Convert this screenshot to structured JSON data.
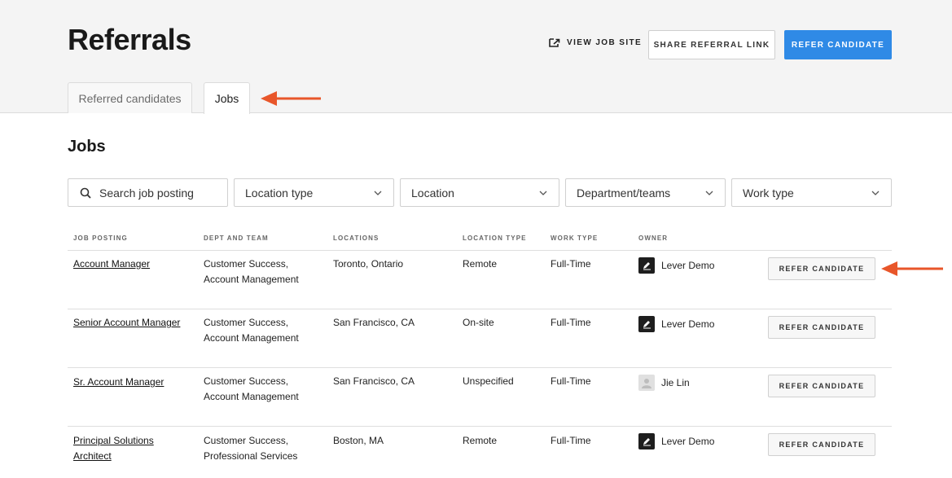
{
  "header": {
    "title": "Referrals",
    "view_job_site": "VIEW JOB SITE",
    "share_referral_link": "SHARE REFERRAL LINK",
    "refer_candidate": "REFER CANDIDATE"
  },
  "tabs": [
    {
      "label": "Referred candidates",
      "active": false
    },
    {
      "label": "Jobs",
      "active": true
    }
  ],
  "section_title": "Jobs",
  "filters": {
    "search_placeholder": "Search job posting",
    "location_type": "Location type",
    "location": "Location",
    "department": "Department/teams",
    "work_type": "Work type"
  },
  "table": {
    "columns": [
      "JOB POSTING",
      "DEPT AND TEAM",
      "LOCATIONS",
      "LOCATION TYPE",
      "WORK TYPE",
      "OWNER"
    ],
    "action_label": "REFER CANDIDATE",
    "rows": [
      {
        "posting": "Account Manager",
        "dept": "Customer Success, Account Management",
        "location": "Toronto, Ontario",
        "location_type": "Remote",
        "work_type": "Full-Time",
        "owner": "Lever Demo",
        "owner_avatar": "pen-logo-icon"
      },
      {
        "posting": "Senior Account Manager",
        "dept": "Customer Success, Account Management",
        "location": "San Francisco, CA",
        "location_type": "On-site",
        "work_type": "Full-Time",
        "owner": "Lever Demo",
        "owner_avatar": "pen-logo-icon"
      },
      {
        "posting": "Sr. Account Manager",
        "dept": "Customer Success, Account Management",
        "location": "San Francisco, CA",
        "location_type": "Unspecified",
        "work_type": "Full-Time",
        "owner": "Jie Lin",
        "owner_avatar": "user-placeholder-icon"
      },
      {
        "posting": "Principal Solutions Architect",
        "dept": "Customer Success, Professional Services",
        "location": "Boston, MA",
        "location_type": "Remote",
        "work_type": "Full-Time",
        "owner": "Lever Demo",
        "owner_avatar": "pen-logo-icon"
      }
    ]
  },
  "colors": {
    "primary": "#2f8ae6",
    "annotation_arrow": "#e8562a",
    "header_bg": "#f4f4f4"
  }
}
